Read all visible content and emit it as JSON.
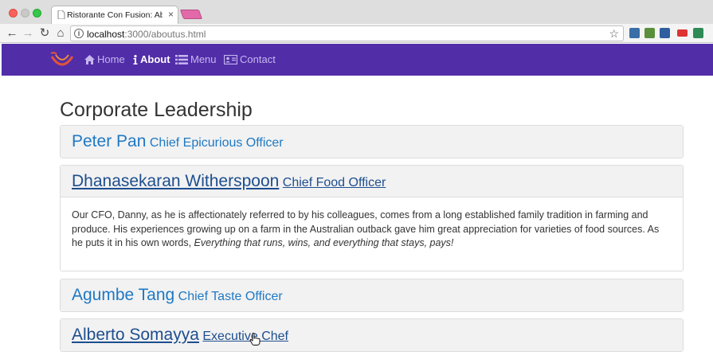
{
  "browser": {
    "tab_title": "Ristorante Con Fusion: About U",
    "tab_close": "×",
    "url_host": "localhost",
    "url_path": ":3000/aboutus.html"
  },
  "navbar": {
    "items": [
      {
        "label": "Home",
        "icon": "home-icon",
        "active": false
      },
      {
        "label": "About",
        "icon": "info-icon",
        "active": true
      },
      {
        "label": "Menu",
        "icon": "list-icon",
        "active": false
      },
      {
        "label": "Contact",
        "icon": "address-card-icon",
        "active": false
      }
    ]
  },
  "main": {
    "title": "Corporate Leadership",
    "leaders": [
      {
        "name": "Peter Pan",
        "role": "Chief Epicurious Officer"
      },
      {
        "name": "Dhanasekaran Witherspoon",
        "role": "Chief Food Officer",
        "bio": "Our CFO, Danny, as he is affectionately referred to by his colleagues, comes from a long established family tradition in farming and produce. His experiences growing up on a farm in the Australian outback gave him great appreciation for varieties of food sources. As he puts it in his own words, ",
        "quote": "Everything that runs, wins, and everything that stays, pays!"
      },
      {
        "name": "Agumbe Tang",
        "role": "Chief Taste Officer"
      },
      {
        "name": "Alberto Somayya",
        "role": "Executive Chef"
      }
    ]
  },
  "colors": {
    "navbar_bg": "#512da8",
    "link": "#1f79c4",
    "link_hover": "#1d4e8f"
  }
}
